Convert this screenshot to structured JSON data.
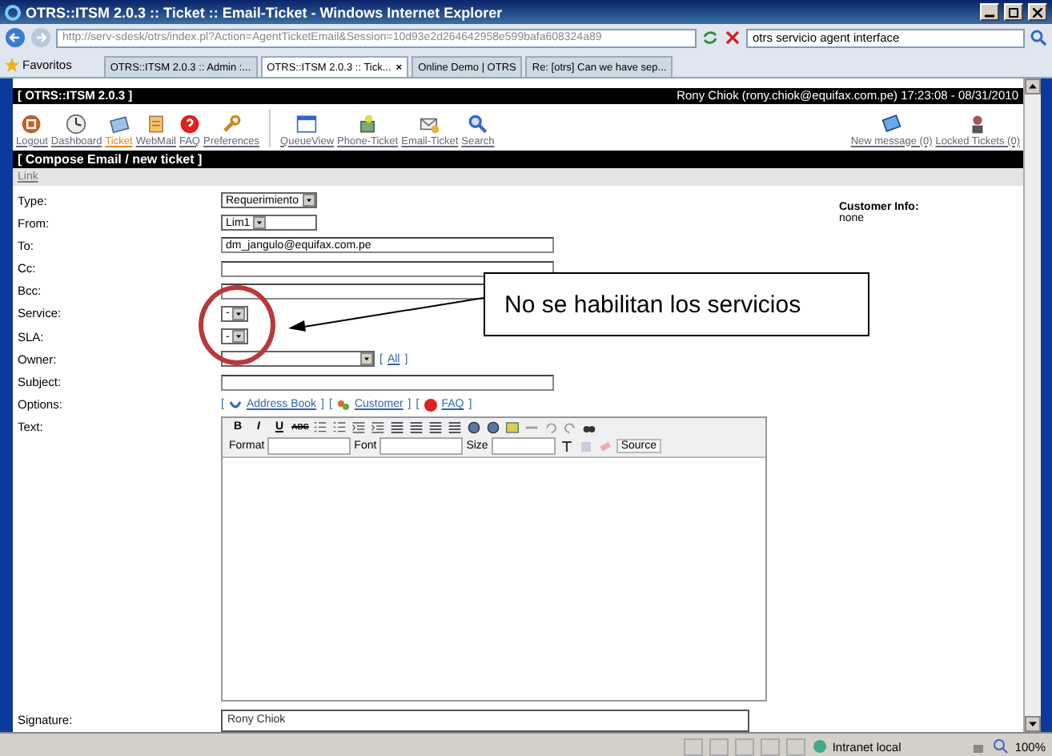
{
  "window": {
    "title": "OTRS::ITSM 2.0.3 :: Ticket :: Email-Ticket - Windows Internet Explorer"
  },
  "browser": {
    "url": "http://serv-sdesk/otrs/index.pl?Action=AgentTicketEmail&Session=10d93e2d264642958e599bafa608324a89",
    "search": "otrs servicio agent interface",
    "favorites": "Favoritos",
    "tabs": [
      {
        "label": "OTRS::ITSM 2.0.3 :: Admin :...",
        "selected": false
      },
      {
        "label": "OTRS::ITSM 2.0.3 :: Tick...",
        "selected": true,
        "close": "×"
      },
      {
        "label": "Online Demo | OTRS",
        "selected": false
      },
      {
        "label": "Re: [otrs] Can we have sep...",
        "selected": false
      }
    ]
  },
  "header": {
    "product": "[ OTRS::ITSM 2.0.3 ]",
    "user": "Rony Chiok (rony.chiok@equifax.com.pe) 17:23:08 - 08/31/2010"
  },
  "nav": {
    "left": [
      {
        "label": "Logout",
        "selected": false
      },
      {
        "label": "Dashboard",
        "selected": false
      },
      {
        "label": "Ticket",
        "selected": true
      },
      {
        "label": "WebMail",
        "selected": false
      },
      {
        "label": "FAQ",
        "selected": false
      },
      {
        "label": "Preferences",
        "selected": false
      }
    ],
    "middle": [
      {
        "label": "QueueView",
        "selected": false
      },
      {
        "label": "Phone-Ticket",
        "selected": false
      },
      {
        "label": "Email-Ticket",
        "selected": false
      },
      {
        "label": "Search",
        "selected": false
      }
    ],
    "right": [
      {
        "label": "New message (0)"
      },
      {
        "label": "Locked Tickets (0)"
      }
    ]
  },
  "page_title": "[ Compose Email / new ticket ]",
  "link_bar": "Link",
  "form": {
    "fields": [
      {
        "label": "Type:",
        "kind": "select",
        "value": "Requerimiento"
      },
      {
        "label": "From:",
        "kind": "select",
        "value": "Lim1"
      },
      {
        "label": "To:",
        "kind": "text",
        "value": "dm_jangulo@equifax.com.pe"
      },
      {
        "label": "Cc:",
        "kind": "text"
      },
      {
        "label": "Bcc:",
        "kind": "text"
      },
      {
        "label": "Service:",
        "kind": "select",
        "value": "-"
      },
      {
        "label": "SLA:",
        "kind": "select",
        "value": "-"
      },
      {
        "label": "Owner:",
        "kind": "owner",
        "link": {
          "label": "All",
          "open": "[",
          "close": "]"
        }
      },
      {
        "label": "Subject:",
        "kind": "text"
      },
      {
        "label": "Options:",
        "kind": "options",
        "links": [
          {
            "label": "Address Book",
            "open": "[",
            "close": "]"
          },
          {
            "label": "Customer",
            "open": "[",
            "close": "]"
          },
          {
            "label": "FAQ",
            "open": "[",
            "close": "]"
          }
        ]
      },
      {
        "label": "Text:",
        "kind": "editor"
      }
    ],
    "customer_info": {
      "label": "Customer Info:",
      "value": "none"
    },
    "editor": {
      "style_buttons": [
        "B",
        "I",
        "U",
        "ABC"
      ],
      "format": "Format",
      "font": "Font",
      "size": "Size",
      "source": "Source"
    },
    "signature": {
      "label": "Signature:",
      "value": "Rony Chiok"
    }
  },
  "annotation": {
    "text": "No se habilitan los servicios"
  },
  "status_bar": {
    "zone": "Intranet local",
    "zoom": "100%"
  }
}
